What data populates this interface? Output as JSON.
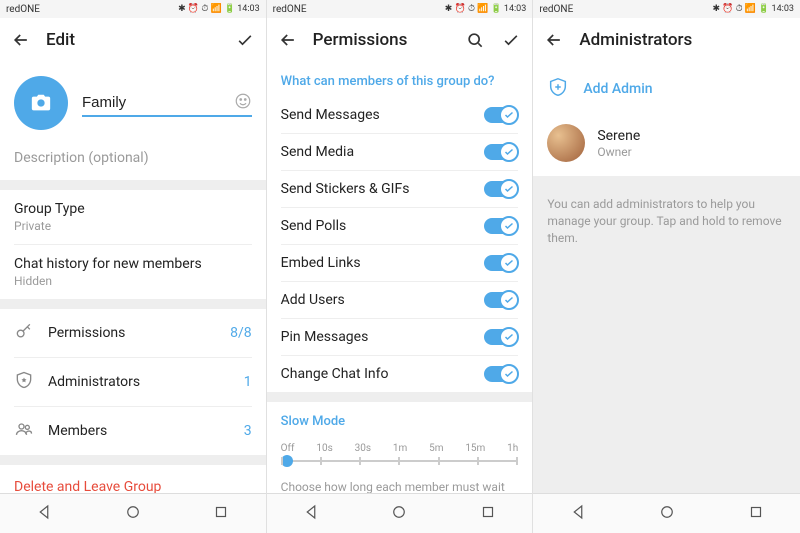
{
  "status": {
    "carrier": "redONE",
    "time": "14:03"
  },
  "panel1": {
    "title": "Edit",
    "group_name": "Family",
    "description_placeholder": "Description (optional)",
    "group_type": {
      "label": "Group Type",
      "value": "Private"
    },
    "chat_history": {
      "label": "Chat history for new members",
      "value": "Hidden"
    },
    "rows": [
      {
        "label": "Permissions",
        "value": "8/8"
      },
      {
        "label": "Administrators",
        "value": "1"
      },
      {
        "label": "Members",
        "value": "3"
      }
    ],
    "danger": "Delete and Leave Group"
  },
  "panel2": {
    "title": "Permissions",
    "section": "What can members of this group do?",
    "perms": [
      "Send Messages",
      "Send Media",
      "Send Stickers & GIFs",
      "Send Polls",
      "Embed Links",
      "Add Users",
      "Pin Messages",
      "Change Chat Info"
    ],
    "slow_mode": {
      "label": "Slow Mode",
      "ticks": [
        "Off",
        "10s",
        "30s",
        "1m",
        "5m",
        "15m",
        "1h"
      ],
      "desc": "Choose how long each member must wait before"
    }
  },
  "panel3": {
    "title": "Administrators",
    "add": "Add Admin",
    "admin": {
      "name": "Serene",
      "role": "Owner"
    },
    "help": "You can add administrators to help you manage your group. Tap and hold to remove them."
  }
}
